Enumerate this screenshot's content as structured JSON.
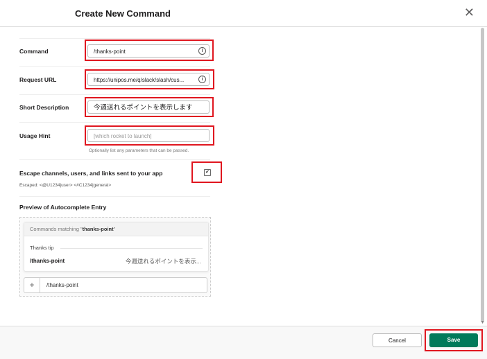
{
  "dialog": {
    "title": "Create New Command",
    "close_icon": "close-icon"
  },
  "form": {
    "command": {
      "label": "Command",
      "value": "/thanks-point"
    },
    "request_url": {
      "label": "Request URL",
      "value": "https://unipos.me/q/slack/slash/cus..."
    },
    "short_description": {
      "label": "Short Description",
      "value": "今週送れるポイントを表示します"
    },
    "usage_hint": {
      "label": "Usage Hint",
      "placeholder": "[which rocket to launch]",
      "helper": "Optionally list any parameters that can be passed."
    },
    "escape": {
      "label": "Escape channels, users, and links sent to your app",
      "example": "Escaped: <@U1234|user> <#C1234|general>",
      "checked": true
    }
  },
  "preview": {
    "title": "Preview of Autocomplete Entry",
    "matching_prefix": "Commands matching \"",
    "matching_term": "thanks-point",
    "matching_suffix": "\"",
    "tip_label": "Thanks tip",
    "command_name": "/thanks-point",
    "command_desc": "今週送れるポイントを表示...",
    "message_text": "/thanks-point"
  },
  "footer": {
    "cancel_label": "Cancel",
    "save_label": "Save"
  },
  "colors": {
    "save_button": "#007a5a",
    "highlight": "#e0161f"
  }
}
